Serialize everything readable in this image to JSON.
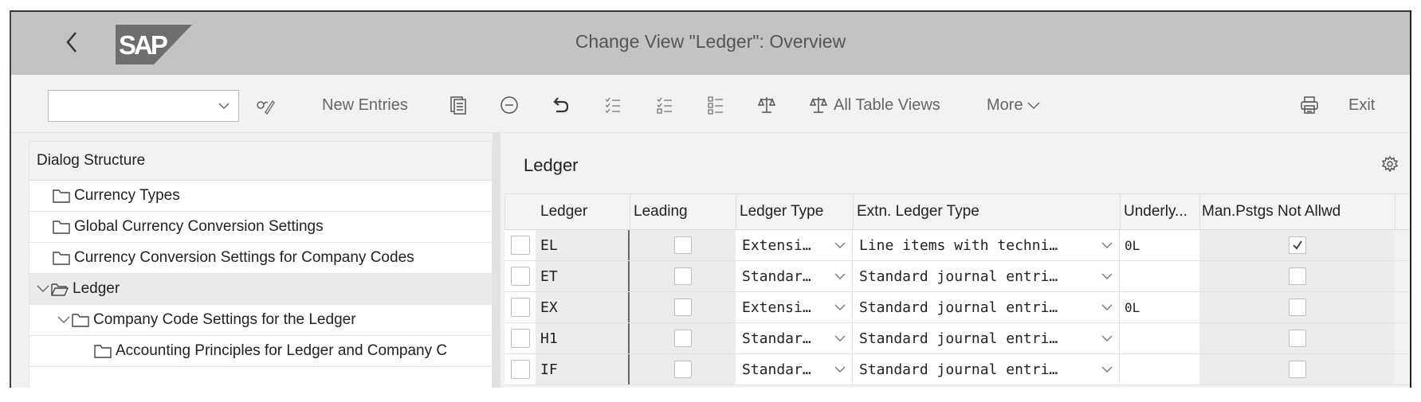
{
  "window": {
    "title": "Change View \"Ledger\": Overview",
    "logo_text": "SAP",
    "back_icon": "chevron-left-icon"
  },
  "toolbar": {
    "select_value": "",
    "items": [
      {
        "name": "display-change-button",
        "icon": "glasses-pencil-icon",
        "label": ""
      },
      {
        "name": "new-entries-button",
        "icon": "",
        "label": "New Entries"
      },
      {
        "name": "copy-as-button",
        "icon": "copy-document-icon",
        "label": ""
      },
      {
        "name": "delete-button",
        "icon": "minus-circle-icon",
        "label": ""
      },
      {
        "name": "undo-button",
        "icon": "undo-icon",
        "label": ""
      },
      {
        "name": "select-all-button",
        "icon": "checklist-all-icon",
        "label": ""
      },
      {
        "name": "select-block-button",
        "icon": "checklist-partial-icon",
        "label": ""
      },
      {
        "name": "deselect-all-button",
        "icon": "checklist-none-icon",
        "label": ""
      },
      {
        "name": "compare-button",
        "icon": "scales-icon",
        "label": ""
      },
      {
        "name": "all-table-views-button",
        "icon": "scales-icon",
        "label": "All Table Views"
      },
      {
        "name": "more-button",
        "icon": "chevron-down-icon",
        "label": "More"
      },
      {
        "name": "print-button",
        "icon": "printer-icon",
        "label": ""
      },
      {
        "name": "exit-button",
        "icon": "",
        "label": "Exit"
      }
    ]
  },
  "dialog_structure": {
    "header": "Dialog Structure",
    "items": [
      {
        "label": "Currency Types",
        "level": 0,
        "expanded": false,
        "selected": false
      },
      {
        "label": "Global Currency Conversion Settings",
        "level": 0,
        "expanded": false,
        "selected": false
      },
      {
        "label": "Currency Conversion Settings for Company Codes",
        "level": 0,
        "expanded": false,
        "selected": false
      },
      {
        "label": "Ledger",
        "level": 0,
        "expanded": true,
        "selected": true
      },
      {
        "label": "Company Code Settings for the Ledger",
        "level": 1,
        "expanded": true,
        "selected": false
      },
      {
        "label": "Accounting Principles for Ledger and Company C",
        "level": 2,
        "expanded": false,
        "selected": false
      }
    ]
  },
  "ledger_table": {
    "section_title": "Ledger",
    "columns": [
      "Ledger",
      "Leading",
      "Ledger Type",
      "Extn. Ledger Type",
      "Underly...",
      "Man.Pstgs Not Allwd"
    ],
    "rows": [
      {
        "ledger": "EL",
        "leading": false,
        "ledger_type": "Extensi…",
        "extn_ledger_type": "Line items with techni…",
        "underlying": "0L",
        "man_pstgs_not_allwd": true
      },
      {
        "ledger": "ET",
        "leading": false,
        "ledger_type": "Standar…",
        "extn_ledger_type": "Standard journal entri…",
        "underlying": "",
        "man_pstgs_not_allwd": false
      },
      {
        "ledger": "EX",
        "leading": false,
        "ledger_type": "Extensi…",
        "extn_ledger_type": "Standard journal entri…",
        "underlying": "0L",
        "man_pstgs_not_allwd": false
      },
      {
        "ledger": "H1",
        "leading": false,
        "ledger_type": "Standar…",
        "extn_ledger_type": "Standard journal entri…",
        "underlying": "",
        "man_pstgs_not_allwd": false
      },
      {
        "ledger": "IF",
        "leading": false,
        "ledger_type": "Standar…",
        "extn_ledger_type": "Standard journal entri…",
        "underlying": "",
        "man_pstgs_not_allwd": false
      }
    ]
  },
  "colors": {
    "title_bar": "#c3c3c3",
    "toolbar": "#f2f2f2",
    "readonly_cell": "#ececec",
    "scroll_thumb": "#b5b5b5"
  }
}
